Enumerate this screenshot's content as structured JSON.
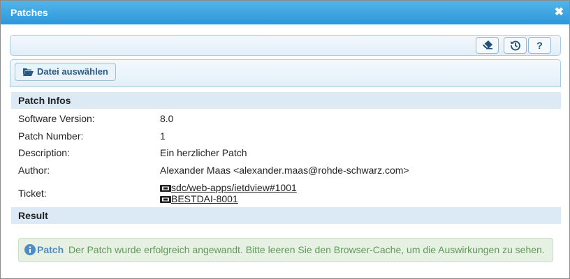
{
  "window": {
    "title": "Patches",
    "close_glyph": "✖"
  },
  "toolbar": {
    "buttons": [
      {
        "icon": "eraser-icon"
      },
      {
        "icon": "history-icon"
      },
      {
        "icon": "help-icon",
        "label": "?"
      }
    ]
  },
  "file_button": {
    "label": "Datei auswählen",
    "icon": "folder-open-icon"
  },
  "patch_infos": {
    "heading": "Patch Infos",
    "rows": [
      {
        "label": "Software Version:",
        "value": "8.0"
      },
      {
        "label": "Patch Number:",
        "value": "1"
      },
      {
        "label": "Description:",
        "value": "Ein herzlicher Patch"
      },
      {
        "label": "Author:",
        "value": "Alexander Maas <alexander.maas@rohde-schwarz.com>"
      }
    ],
    "ticket_label": "Ticket:",
    "tickets": [
      "sdc/web-apps/ietdview#1001",
      "BESTDAI-8001"
    ]
  },
  "result": {
    "heading": "Result",
    "alert_label": "Patch",
    "alert_message": "Der Patch wurde erfolgreich angewandt. Bitte leeren Sie den Browser-Cache, um die Auswirkungen zu sehen."
  },
  "colors": {
    "titlebar": "#2d98d8",
    "section_bg": "#dceaf6",
    "success_bg": "#e6f1e4",
    "success_text": "#5f9a55"
  }
}
